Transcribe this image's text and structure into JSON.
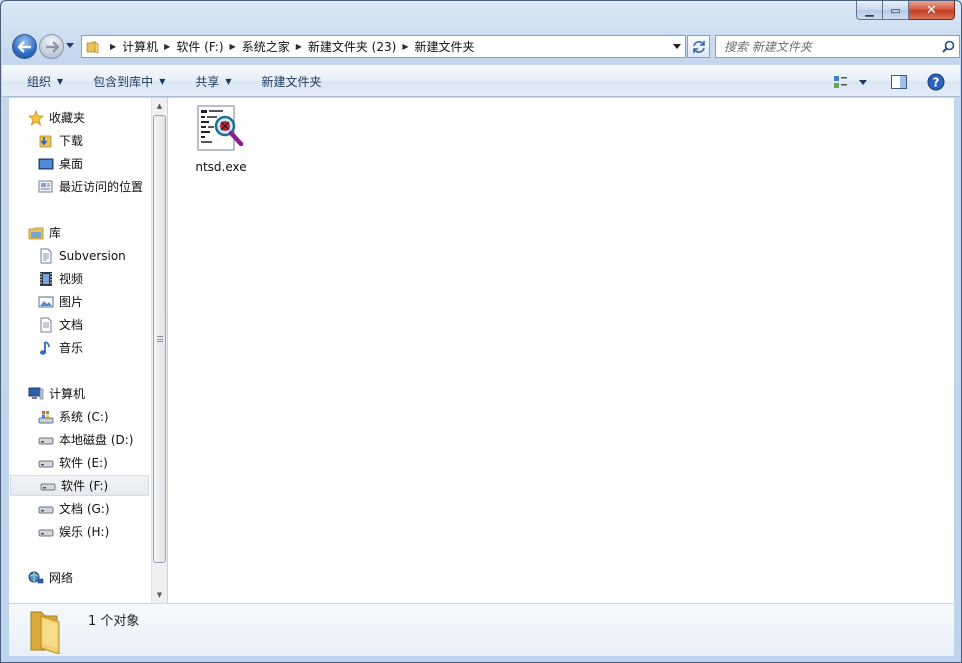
{
  "window": {
    "caption": {
      "minimize": "▁",
      "maximize": "▭",
      "close": "✕"
    }
  },
  "nav": {
    "breadcrumbs": [
      "计算机",
      "软件 (F:)",
      "系统之家",
      "新建文件夹 (23)",
      "新建文件夹"
    ],
    "search_placeholder": "搜索 新建文件夹"
  },
  "toolbar": {
    "organize": "组织",
    "include_in_library": "包含到库中",
    "share": "共享",
    "new_folder": "新建文件夹"
  },
  "sidebar": {
    "favorites": {
      "label": "收藏夹",
      "items": [
        "下载",
        "桌面",
        "最近访问的位置"
      ]
    },
    "libraries": {
      "label": "库",
      "items": [
        "Subversion",
        "视频",
        "图片",
        "文档",
        "音乐"
      ]
    },
    "computer": {
      "label": "计算机",
      "items": [
        "系统 (C:)",
        "本地磁盘 (D:)",
        "软件 (E:)",
        "软件 (F:)",
        "文档 (G:)",
        "娱乐 (H:)"
      ],
      "selected": "软件 (F:)"
    },
    "network": {
      "label": "网络"
    }
  },
  "files": [
    {
      "name": "ntsd.exe",
      "icon": "executable-debug-icon"
    }
  ],
  "details": {
    "count_text": "1 个对象"
  },
  "colors": {
    "accent": "#2f6cc4",
    "selection": "#e6e9ee",
    "close": "#c43b1f"
  }
}
